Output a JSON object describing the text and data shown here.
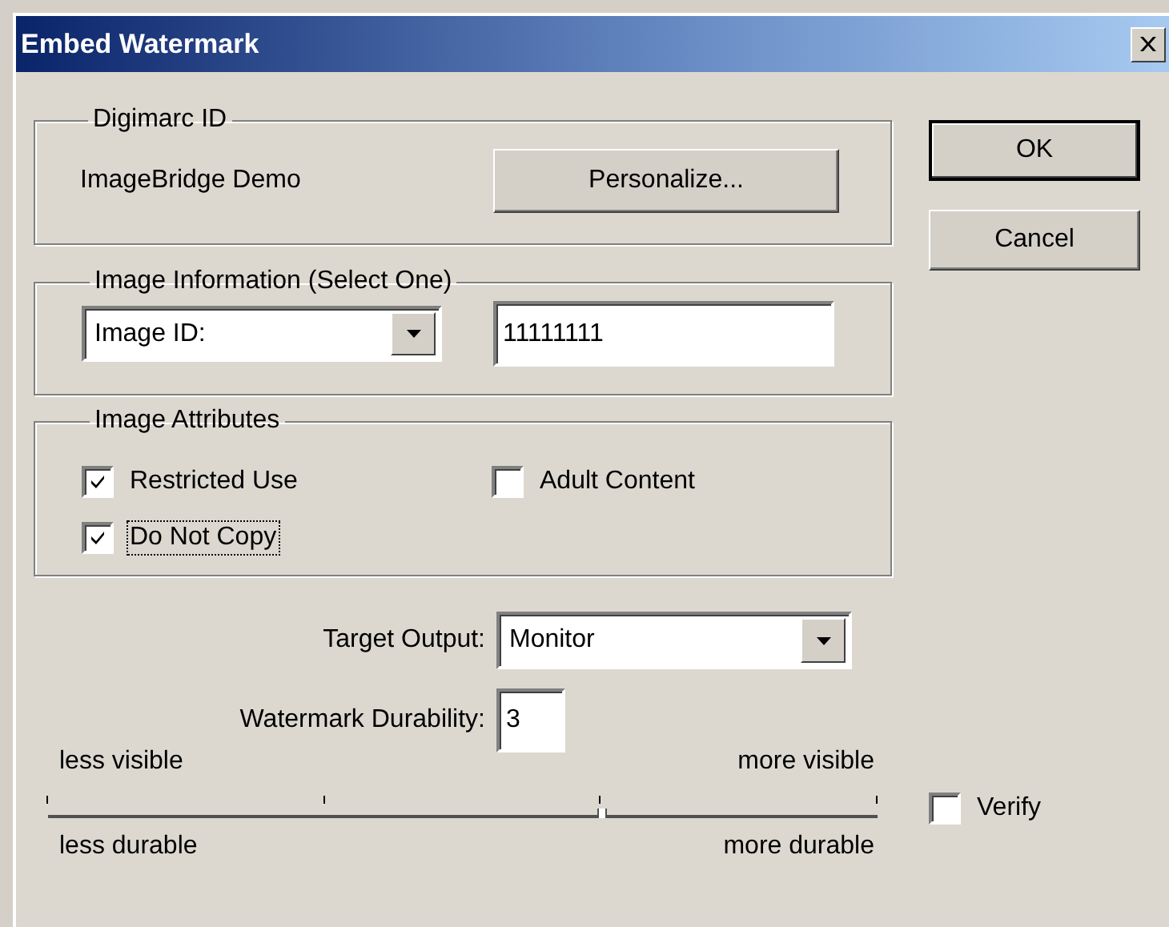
{
  "window": {
    "title": "Embed Watermark"
  },
  "digimarc_id": {
    "legend": "Digimarc ID",
    "name": "ImageBridge Demo",
    "button": "Personalize..."
  },
  "image_information": {
    "legend": "Image Information (Select One)",
    "type_dropdown": {
      "value": "Image ID:"
    },
    "id_field": {
      "value": "11111111"
    }
  },
  "image_attributes": {
    "legend": "Image Attributes",
    "checkboxes": [
      {
        "label": "Restricted Use",
        "checked": true,
        "focused": false
      },
      {
        "label": "Adult Content",
        "checked": false,
        "focused": false
      },
      {
        "label": "Do Not Copy",
        "checked": true,
        "focused": true
      }
    ]
  },
  "target_output": {
    "label": "Target Output:",
    "value": "Monitor"
  },
  "durability": {
    "label": "Watermark Durability:",
    "value": "3"
  },
  "slider": {
    "top_left": "less visible",
    "top_right": "more visible",
    "bottom_left": "less durable",
    "bottom_right": "more durable",
    "level": 0.667
  },
  "verify": {
    "label": "Verify",
    "checked": false,
    "focused": false
  },
  "buttons": [
    {
      "label": "OK",
      "default": true
    },
    {
      "label": "Cancel",
      "default": false
    }
  ]
}
